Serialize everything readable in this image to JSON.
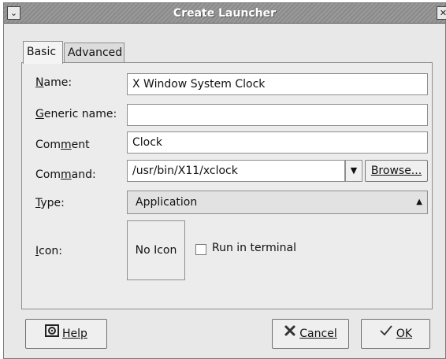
{
  "window": {
    "title": "Create Launcher",
    "menu_icon": "chevron-down-icon",
    "close_icon": "close-icon"
  },
  "tabs": [
    {
      "label": "Basic",
      "active": true
    },
    {
      "label": "Advanced",
      "active": false
    }
  ],
  "form": {
    "name": {
      "label": "Name:",
      "value": "X Window System Clock"
    },
    "generic_name": {
      "label": "Generic name:",
      "value": ""
    },
    "comment": {
      "label": "Comment",
      "value": "Clock"
    },
    "command": {
      "label": "Command:",
      "value": "/usr/bin/X11/xclock",
      "browse_label": "Browse..."
    },
    "type": {
      "label": "Type:",
      "value": "Application"
    },
    "icon": {
      "label": "Icon:",
      "button_text": "No Icon"
    },
    "run_in_terminal": {
      "label": "Run in terminal",
      "checked": false
    }
  },
  "buttons": {
    "help": "Help",
    "cancel": "Cancel",
    "ok": "OK"
  }
}
